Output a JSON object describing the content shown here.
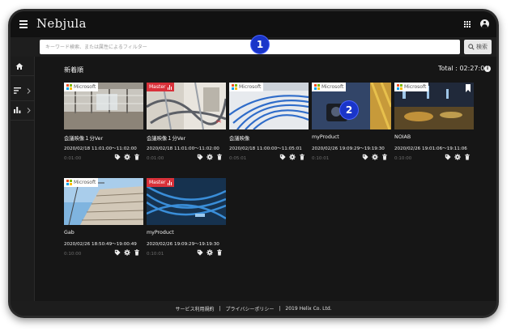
{
  "app": {
    "title": "Nebjula"
  },
  "search": {
    "placeholder": "キーワード検索、または属性によるフィルター",
    "button_label": "検索"
  },
  "sidebar": {
    "items": [
      {
        "icon": "home-icon"
      },
      {
        "icon": "sort-icon"
      },
      {
        "icon": "bar-chart-icon"
      }
    ]
  },
  "main": {
    "section_title": "新着順",
    "total": "Total : 02:27:04",
    "info_glyph": "i"
  },
  "badges": {
    "microsoft": "Microsoft",
    "master": "Master"
  },
  "cards": [
    {
      "badge": "microsoft",
      "title": "会議映像１分Ver",
      "time": "2020/02/18 11:01:00〜11:02:00",
      "duration": "0:01:00"
    },
    {
      "badge": "master",
      "title": "会議映像１分Ver",
      "time": "2020/02/18 11:01:00〜11:02:00",
      "duration": "0:01:00"
    },
    {
      "badge": "microsoft",
      "title": "会議映像",
      "time": "2020/02/18 11:00:00〜11:05:01",
      "duration": "0:05:01"
    },
    {
      "badge": "microsoft",
      "title": "myProduct",
      "time": "2020/02/26 19:09:29〜19:19:30",
      "duration": "0:10:01"
    },
    {
      "badge": "microsoft",
      "title": "NOIAB",
      "time": "2020/02/26 19:01:06〜19:11:06",
      "duration": "0:10:00"
    },
    {
      "badge": "microsoft",
      "title": "Gab",
      "time": "2020/02/26 18:50:49〜19:00:49",
      "duration": "0:10:00"
    },
    {
      "badge": "master",
      "title": "myProduct",
      "time": "2020/02/26 19:09:29〜19:19:30",
      "duration": "0:10:01"
    }
  ],
  "markers": [
    "1",
    "2"
  ],
  "footer": {
    "links": [
      "サービス利用規約",
      "プライバシーポリシー"
    ],
    "separator": "|",
    "copyright": "2019 Helix Co. Ltd."
  },
  "colors": {
    "background": "#161616",
    "master_badge": "#d9313a",
    "marker": "#1a35c9",
    "ms_red": "#f25022",
    "ms_green": "#7fba00",
    "ms_blue": "#00a4ef",
    "ms_yellow": "#ffb900"
  }
}
